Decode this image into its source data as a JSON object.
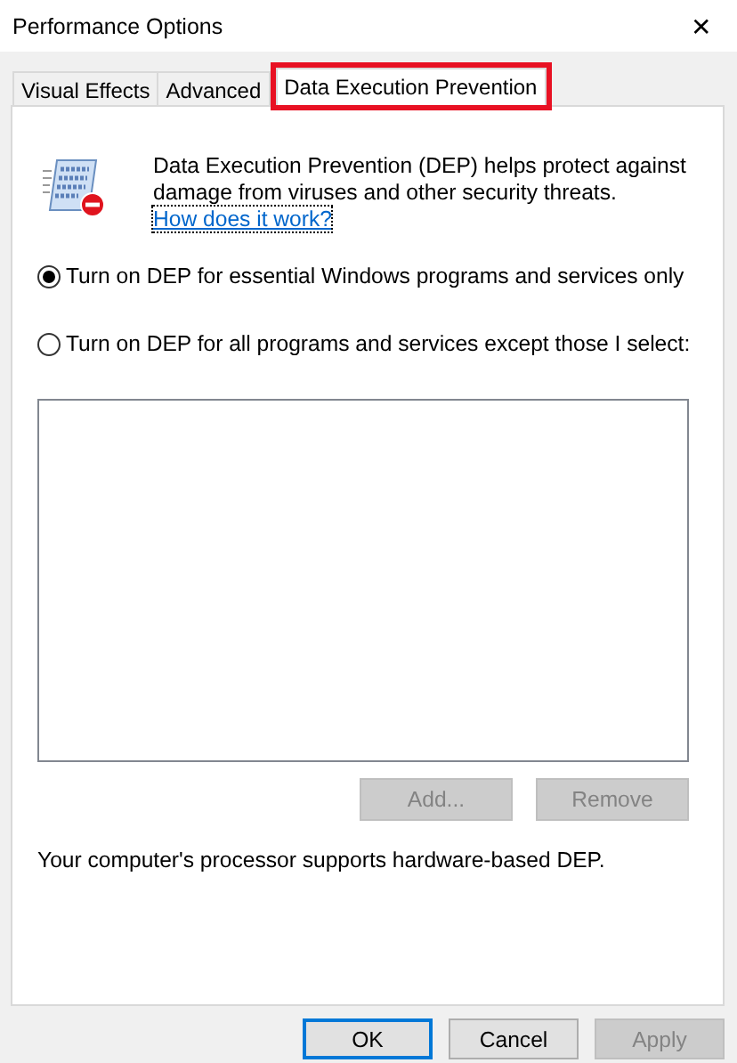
{
  "window": {
    "title": "Performance Options",
    "close": "✕"
  },
  "tabs": [
    {
      "label": "Visual Effects",
      "selected": false,
      "highlighted": false
    },
    {
      "label": "Advanced",
      "selected": false,
      "highlighted": false
    },
    {
      "label": "Data Execution Prevention",
      "selected": true,
      "highlighted": true
    }
  ],
  "description": {
    "text": "Data Execution Prevention (DEP) helps protect against damage from viruses and other security threats.",
    "link": "How does it work?"
  },
  "options": [
    {
      "label": "Turn on DEP for essential Windows programs and services only",
      "selected": true
    },
    {
      "label": "Turn on DEP for all programs and services except those I select:",
      "selected": false
    }
  ],
  "list_buttons": [
    {
      "label": "Add...",
      "disabled": true
    },
    {
      "label": "Remove",
      "disabled": true
    }
  ],
  "status": "Your computer's processor supports hardware-based DEP.",
  "buttons": [
    {
      "label": "OK",
      "disabled": false,
      "default": true
    },
    {
      "label": "Cancel",
      "disabled": false,
      "default": false
    },
    {
      "label": "Apply",
      "disabled": true,
      "default": false
    }
  ]
}
